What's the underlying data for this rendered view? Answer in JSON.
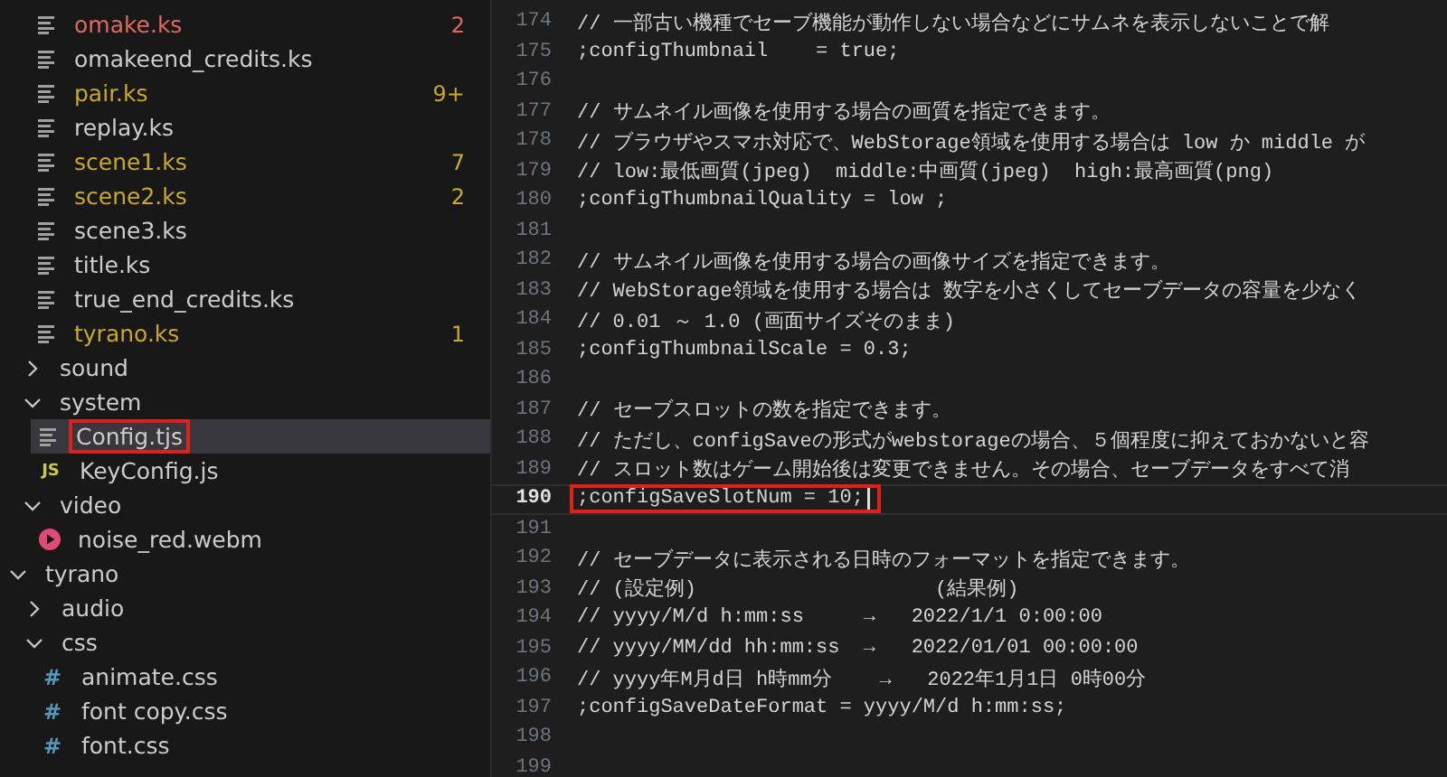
{
  "sidebar": {
    "tree": [
      {
        "kind": "group",
        "children": [
          {
            "kind": "group",
            "children": [
              {
                "label": "omake.ks",
                "kind": "file",
                "color": "#e0695e",
                "badge": "2",
                "selected": false
              },
              {
                "label": "omakeend_credits.ks",
                "kind": "file",
                "selected": false
              },
              {
                "label": "pair.ks",
                "kind": "file",
                "color": "#c9a826",
                "badge": "9+",
                "selected": false
              },
              {
                "label": "replay.ks",
                "kind": "file",
                "selected": false
              },
              {
                "label": "scene1.ks",
                "kind": "file",
                "color": "#c9a826",
                "badge": "7",
                "selected": false
              },
              {
                "label": "scene2.ks",
                "kind": "file",
                "color": "#c9a826",
                "badge": "2",
                "selected": false
              },
              {
                "label": "scene3.ks",
                "kind": "file",
                "selected": false
              },
              {
                "label": "title.ks",
                "kind": "file",
                "selected": false
              },
              {
                "label": "true_end_credits.ks",
                "kind": "file",
                "selected": false
              },
              {
                "label": "tyrano.ks",
                "kind": "file",
                "color": "#c9a826",
                "badge": "1",
                "selected": false
              }
            ]
          },
          {
            "label": "sound",
            "kind": "folder",
            "expanded": false,
            "selected": false
          },
          {
            "label": "system",
            "kind": "folder",
            "expanded": true,
            "selected": false,
            "children": [
              {
                "label": "Config.tjs",
                "kind": "file",
                "selected": true,
                "highlighted": true
              },
              {
                "label": "KeyConfig.js",
                "kind": "glyph",
                "glyph": "JS",
                "selected": false
              }
            ]
          },
          {
            "label": "video",
            "kind": "folder",
            "expanded": true,
            "selected": false,
            "children": [
              {
                "label": "noise_red.webm",
                "kind": "video",
                "selected": false
              }
            ]
          }
        ]
      },
      {
        "label": "tyrano",
        "kind": "folder",
        "expanded": true,
        "selected": false,
        "children": [
          {
            "label": "audio",
            "kind": "folder",
            "expanded": false,
            "selected": false
          },
          {
            "label": "css",
            "kind": "folder",
            "expanded": true,
            "selected": false,
            "children": [
              {
                "label": "animate.css",
                "kind": "glyph",
                "glyph": "#",
                "selected": false
              },
              {
                "label": "font copy.css",
                "kind": "glyph",
                "glyph": "#",
                "selected": false
              },
              {
                "label": "font.css",
                "kind": "glyph",
                "glyph": "#",
                "selected": false
              }
            ]
          }
        ]
      }
    ]
  },
  "editor": {
    "lines": [
      {
        "number": "174",
        "text": "// 一部古い機種でセーブ機能が動作しない場合などにサムネを表示しないことで解",
        "current": false
      },
      {
        "number": "175",
        "text": ";configThumbnail    = true;",
        "current": false
      },
      {
        "number": "176",
        "current": false
      },
      {
        "number": "177",
        "text": "// サムネイル画像を使用する場合の画質を指定できます。",
        "current": false
      },
      {
        "number": "178",
        "text": "// ブラウザやスマホ対応で、WebStorage領域を使用する場合は low か middle が",
        "current": false
      },
      {
        "number": "179",
        "text": "// low:最低画質(jpeg)  middle:中画質(jpeg)  high:最高画質(png)",
        "current": false
      },
      {
        "number": "180",
        "text": ";configThumbnailQuality = low ;",
        "current": false
      },
      {
        "number": "181",
        "current": false
      },
      {
        "number": "182",
        "text": "// サムネイル画像を使用する場合の画像サイズを指定できます。",
        "current": false
      },
      {
        "number": "183",
        "text": "// WebStorage領域を使用する場合は 数字を小さくしてセーブデータの容量を少なく",
        "current": false
      },
      {
        "number": "184",
        "text": "// 0.01 ～ 1.0 (画面サイズそのまま)",
        "current": false
      },
      {
        "number": "185",
        "text": ";configThumbnailScale = 0.3;",
        "current": false
      },
      {
        "number": "186",
        "current": false
      },
      {
        "number": "187",
        "text": "// セーブスロットの数を指定できます。",
        "current": false
      },
      {
        "number": "188",
        "text": "// ただし、configSaveの形式がwebstorageの場合、５個程度に抑えておかないと容",
        "current": false
      },
      {
        "number": "189",
        "text": "// スロット数はゲーム開始後は変更できません。その場合、セーブデータをすべて消",
        "current": false
      },
      {
        "number": "190",
        "text": ";configSaveSlotNum = 10;",
        "current": true,
        "highlighted": true
      },
      {
        "number": "191",
        "current": false
      },
      {
        "number": "192",
        "text": "// セーブデータに表示される日時のフォーマットを指定できます。",
        "current": false
      },
      {
        "number": "193",
        "text": "// (設定例)                    (結果例)",
        "current": false
      },
      {
        "number": "194",
        "text": "// yyyy/M/d h:mm:ss     →   2022/1/1 0:00:00",
        "current": false
      },
      {
        "number": "195",
        "text": "// yyyy/MM/dd hh:mm:ss  →   2022/01/01 00:00:00",
        "current": false
      },
      {
        "number": "196",
        "text": "// yyyy年M月d日 h時mm分    →   2022年1月1日 0時00分",
        "current": false
      },
      {
        "number": "197",
        "text": ";configSaveDateFormat = yyyy/M/d h:mm:ss;",
        "current": false
      },
      {
        "number": "198",
        "current": false
      },
      {
        "number": "199",
        "current": false
      }
    ]
  }
}
